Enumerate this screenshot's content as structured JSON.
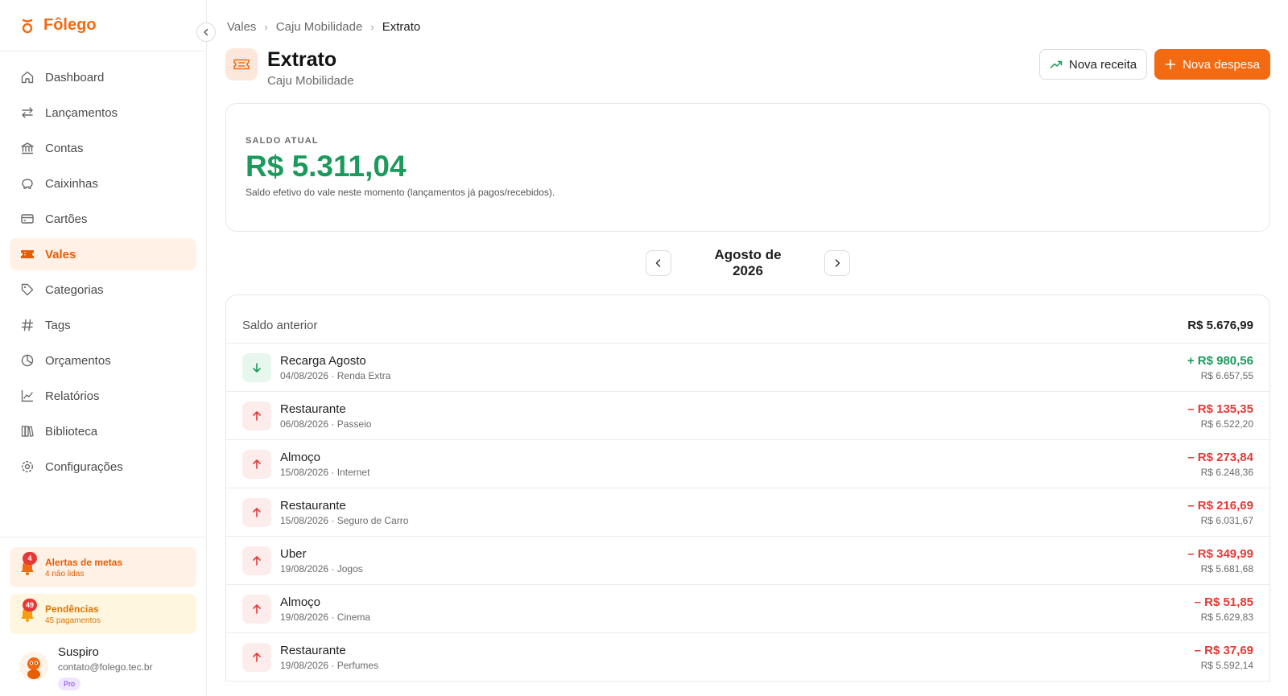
{
  "brand": {
    "name": "Fôlego",
    "accent": "#f26a12"
  },
  "sidebar": {
    "items": [
      {
        "label": "Dashboard",
        "icon": "home-icon"
      },
      {
        "label": "Lançamentos",
        "icon": "arrows-icon"
      },
      {
        "label": "Contas",
        "icon": "bank-icon"
      },
      {
        "label": "Caixinhas",
        "icon": "piggy-bank-icon"
      },
      {
        "label": "Cartões",
        "icon": "card-icon"
      },
      {
        "label": "Vales",
        "icon": "ticket-icon",
        "active": true
      },
      {
        "label": "Categorias",
        "icon": "tag-icon"
      },
      {
        "label": "Tags",
        "icon": "hash-icon"
      },
      {
        "label": "Orçamentos",
        "icon": "pie-icon"
      },
      {
        "label": "Relatórios",
        "icon": "chart-icon"
      },
      {
        "label": "Biblioteca",
        "icon": "library-icon"
      },
      {
        "label": "Configurações",
        "icon": "gear-icon"
      }
    ],
    "alerts": {
      "metas": {
        "title": "Alertas de metas",
        "sub": "4 não lidas",
        "badge": "4"
      },
      "pendencias": {
        "title": "Pendências",
        "sub": "45 pagamentos",
        "badge": "49"
      }
    },
    "user": {
      "name": "Suspiro",
      "email": "contato@folego.tec.br",
      "plan": "Pro"
    }
  },
  "breadcrumb": [
    "Vales",
    "Caju Mobilidade",
    "Extrato"
  ],
  "header": {
    "title": "Extrato",
    "subtitle": "Caju Mobilidade",
    "btn_income": "Nova receita",
    "btn_expense": "Nova despesa"
  },
  "balance": {
    "label": "SALDO ATUAL",
    "value": "R$ 5.311,04",
    "note": "Saldo efetivo do vale neste momento (lançamentos já pagos/recebidos)."
  },
  "month": {
    "label": "Agosto de 2026"
  },
  "statement": {
    "previous_label": "Saldo anterior",
    "previous_value": "R$ 5.676,99",
    "rows": [
      {
        "type": "in",
        "title": "Recarga Agosto",
        "meta": "04/08/2026 · Renda Extra",
        "amount": "+ R$ 980,56",
        "balance": "R$ 6.657,55"
      },
      {
        "type": "out",
        "title": "Restaurante",
        "meta": "06/08/2026 · Passeio",
        "amount": "– R$ 135,35",
        "balance": "R$ 6.522,20"
      },
      {
        "type": "out",
        "title": "Almoço",
        "meta": "15/08/2026 · Internet",
        "amount": "– R$ 273,84",
        "balance": "R$ 6.248,36"
      },
      {
        "type": "out",
        "title": "Restaurante",
        "meta": "15/08/2026 · Seguro de Carro",
        "amount": "– R$ 216,69",
        "balance": "R$ 6.031,67"
      },
      {
        "type": "out",
        "title": "Uber",
        "meta": "19/08/2026 · Jogos",
        "amount": "– R$ 349,99",
        "balance": "R$ 5.681,68"
      },
      {
        "type": "out",
        "title": "Almoço",
        "meta": "19/08/2026 · Cinema",
        "amount": "– R$ 51,85",
        "balance": "R$ 5.629,83"
      },
      {
        "type": "out",
        "title": "Restaurante",
        "meta": "19/08/2026 · Perfumes",
        "amount": "– R$ 37,69",
        "balance": "R$ 5.592,14"
      }
    ]
  }
}
